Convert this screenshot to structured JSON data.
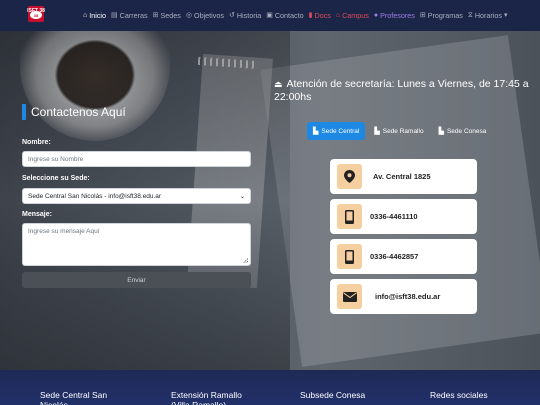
{
  "nav": {
    "logo_text": "ISFT 38",
    "items": [
      {
        "label": "Inicio",
        "icon": "home-icon"
      },
      {
        "label": "Carreras",
        "icon": "book-icon"
      },
      {
        "label": "Sedes",
        "icon": "sitemap-icon"
      },
      {
        "label": "Objetivos",
        "icon": "target-icon"
      },
      {
        "label": "Historia",
        "icon": "history-icon"
      },
      {
        "label": "Contacto",
        "icon": "id-card-icon"
      },
      {
        "label": "Docs",
        "icon": "file-icon"
      },
      {
        "label": "Campus",
        "icon": "university-icon"
      },
      {
        "label": "Profesores",
        "icon": "users-icon"
      },
      {
        "label": "Programas",
        "icon": "list-icon"
      },
      {
        "label": "Horarios",
        "icon": "hourglass-icon"
      }
    ],
    "colors": {
      "background": "#1a2548",
      "active": "#ffffff",
      "docs": "#e24a58",
      "campus": "#e24a58",
      "profesores": "#9d7ee8"
    }
  },
  "contact": {
    "title": "Contactenos Aquí",
    "name_label": "Nombre:",
    "name_placeholder": "Ingrese su Nombre",
    "sede_label": "Seleccione su Sede:",
    "sede_value": "Sede Central San Nicolás - info@isft38.edu.ar",
    "message_label": "Mensaje:",
    "message_placeholder": "Ingrese su mensaje Aquí",
    "send_label": "Enviar"
  },
  "info": {
    "hours_text": "Atención de secretaría: Lunes a Viernes, de 17:45 a 22:00hs",
    "tabs": [
      "Sede Central",
      "Sede Ramallo",
      "Sede Conesa"
    ],
    "active_tab": "Sede Central",
    "cards": [
      {
        "icon": "map-marker-icon",
        "text": "Av. Central 1825"
      },
      {
        "icon": "mobile-phone-icon",
        "text": "0336-4461110"
      },
      {
        "icon": "mobile-phone-icon",
        "text": "0336-4462857"
      },
      {
        "icon": "envelope-icon",
        "text": "info@isft38.edu.ar"
      }
    ],
    "accent": "#1e88e5",
    "icon_bg": "#f5cfa0"
  },
  "footer": {
    "columns": [
      "Sede Central San Nicolás",
      "Extensión Ramallo (Villa Ramallo)",
      "Subsede Conesa",
      "Redes sociales"
    ]
  }
}
